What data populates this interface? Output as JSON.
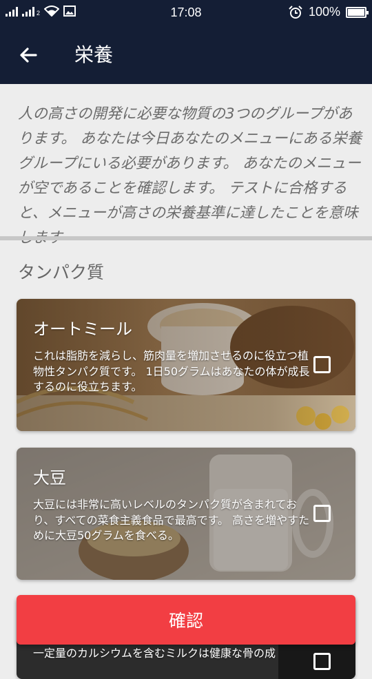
{
  "status_bar": {
    "time": "17:08",
    "battery": "100%",
    "battery_level": 1.0,
    "signal_sim2_label": "2"
  },
  "app_bar": {
    "title": "栄養",
    "back_icon": "arrow-left-icon"
  },
  "intro": {
    "text": "人の高さの開発に必要な物質の3つのグループがあります。 あなたは今日あなたのメニューにある栄養グループにいる必要があります。 あなたのメニューが空であることを確認します。 テストに合格すると、メニューが高さの栄養基準に達したことを意味します"
  },
  "section": {
    "title": "タンパク質"
  },
  "foods": [
    {
      "name": "オートミール",
      "description": "これは脂肪を減らし、筋肉量を増加させるのに役立つ植物性タンパク質です。 1日50グラムはあなたの体が成長するのに役立ちます。",
      "checked": false
    },
    {
      "name": "大豆",
      "description": "大豆には非常に高いレベルのタンパク質が含まれており、すべての菜食主義食品で最高です。 高さを増やすために大豆50グラムを食べる。",
      "checked": false
    },
    {
      "name": "",
      "description": "一定量のカルシウムを含むミルクは健康な骨の成",
      "checked": false
    }
  ],
  "confirm_button": {
    "label": "確認"
  },
  "colors": {
    "app_bar": "#141e35",
    "background": "#ededed",
    "confirm": "#f23e43",
    "intro_text": "#6b6b6b"
  }
}
